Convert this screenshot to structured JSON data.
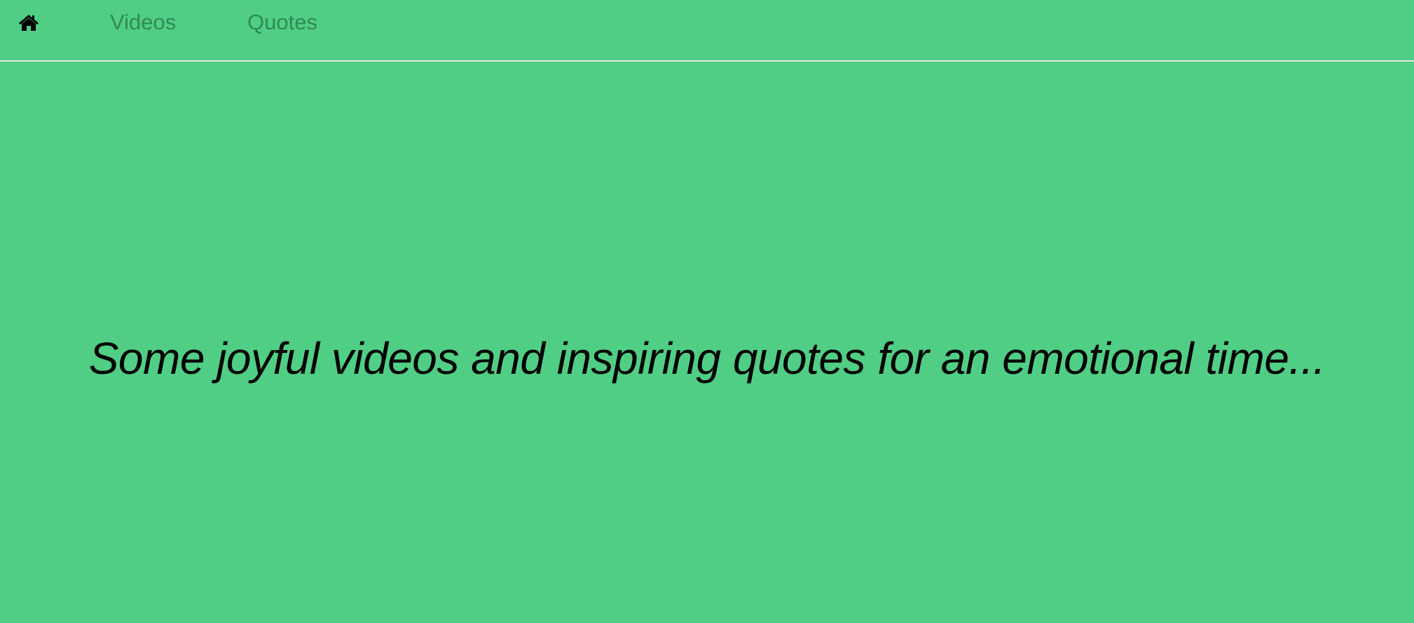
{
  "nav": {
    "home_icon": "home-icon",
    "links": [
      {
        "label": "Videos"
      },
      {
        "label": "Quotes"
      }
    ]
  },
  "main": {
    "tagline": "Some joyful videos and inspiring quotes for an emotional time..."
  },
  "colors": {
    "background": "#51ce85",
    "nav_link": "#2f8a57",
    "divider": "#e6e6e6"
  }
}
